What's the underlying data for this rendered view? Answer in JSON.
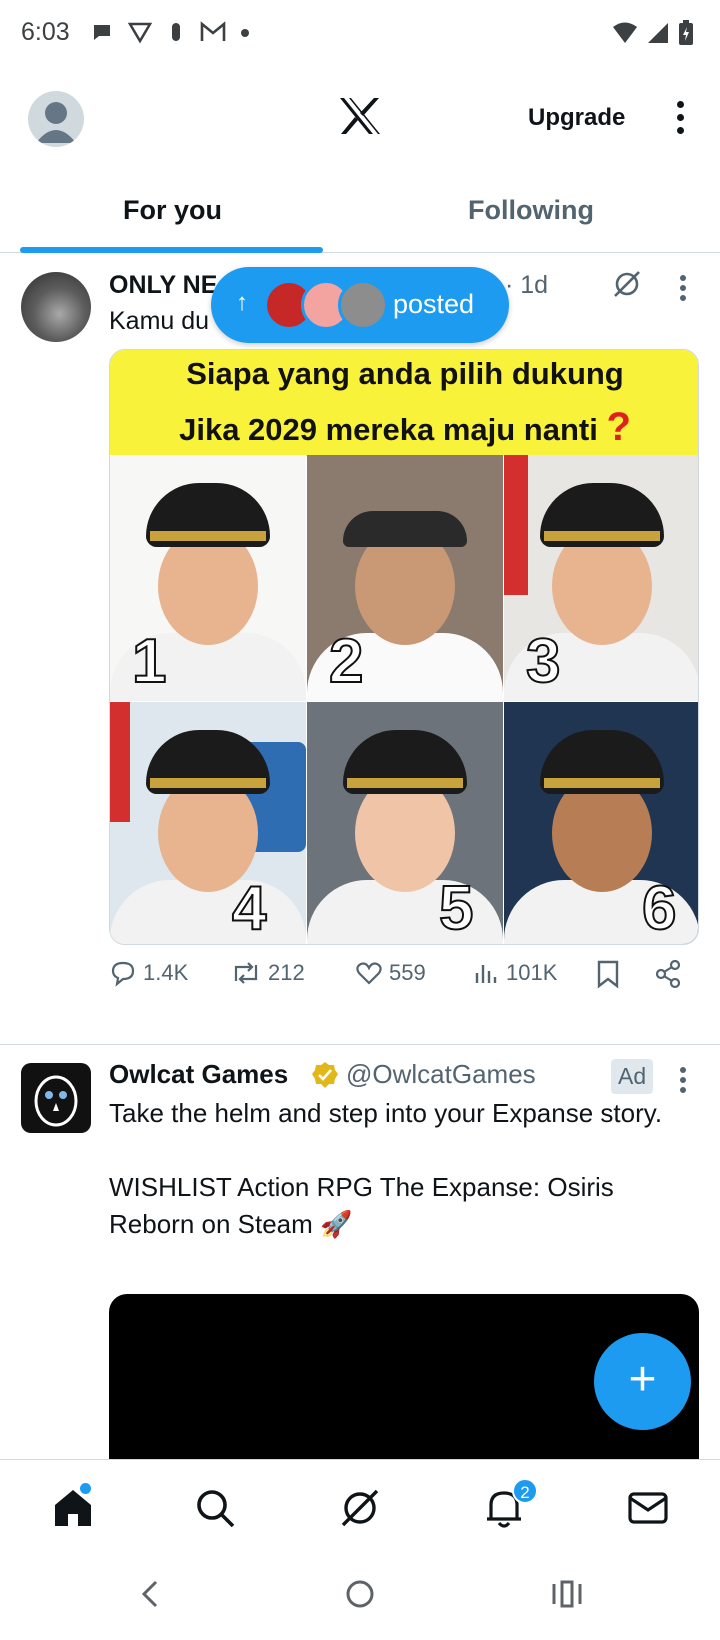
{
  "status_bar": {
    "time": "6:03",
    "notification_icons": [
      "chat-bubble-icon",
      "vpn-icon",
      "hand-icon",
      "gmail-icon",
      "dot-icon"
    ],
    "right_icons": [
      "wifi-icon",
      "signal-icon",
      "battery-icon"
    ]
  },
  "header": {
    "logo": "x-logo-icon",
    "upgrade_label": "Upgrade"
  },
  "tabs": {
    "for_you": "For you",
    "following": "Following",
    "active": "For you"
  },
  "posted_pill": {
    "label": "posted"
  },
  "tweet1": {
    "author_name": "ONLY NE",
    "time": "· 1d",
    "text": "Kamu du",
    "media": {
      "line1": "Siapa yang anda pilih dukung",
      "line2": "Jika 2029 mereka maju nanti",
      "question_mark": "?",
      "numbers": [
        "1",
        "2",
        "3",
        "4",
        "5",
        "6"
      ]
    },
    "stats": {
      "replies": "1.4K",
      "reposts": "212",
      "likes": "559",
      "views": "101K"
    }
  },
  "tweet2": {
    "author_name": "Owlcat Games",
    "handle": "@OwlcatGames",
    "ad_label": "Ad",
    "text": "Take the helm and step into your Expanse story.\n\nWISHLIST Action RPG The Expanse: Osiris Reborn on Steam 🚀"
  },
  "fab": {
    "label": "+"
  },
  "bottom_nav": {
    "notifications_badge": "2"
  },
  "colors": {
    "accent": "#1d9bf0",
    "text_primary": "#0f1419",
    "text_secondary": "#536471"
  }
}
